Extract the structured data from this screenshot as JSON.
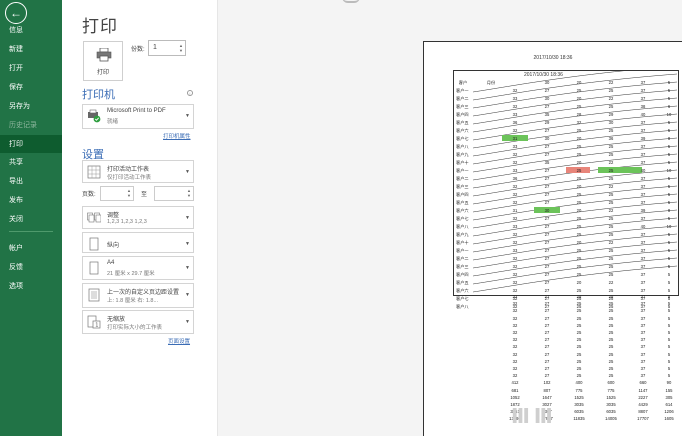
{
  "nav": {
    "back_glyph": "←",
    "items": [
      {
        "label": "信息",
        "state": "normal"
      },
      {
        "label": "新建",
        "state": "normal"
      },
      {
        "label": "打开",
        "state": "normal"
      },
      {
        "label": "保存",
        "state": "normal"
      },
      {
        "label": "另存为",
        "state": "normal"
      },
      {
        "label": "历史记录",
        "state": "disabled"
      },
      {
        "label": "打印",
        "state": "active"
      },
      {
        "label": "共享",
        "state": "normal"
      },
      {
        "label": "导出",
        "state": "normal"
      },
      {
        "label": "发布",
        "state": "normal"
      },
      {
        "label": "关闭",
        "state": "normal"
      },
      {
        "label": "帐户",
        "state": "normal"
      },
      {
        "label": "反馈",
        "state": "normal"
      },
      {
        "label": "选项",
        "state": "normal"
      }
    ]
  },
  "panel": {
    "title": "打印",
    "print_button_label": "打印",
    "copies_label": "份数:",
    "copies_value": "1",
    "printer_heading": "打印机",
    "printer_info_glyph": "i",
    "printer_name": "Microsoft Print to PDF",
    "printer_status": "就绪",
    "printer_properties_link": "打印机属性",
    "settings_heading": "设置",
    "settings": {
      "print_what": {
        "line1": "打印活动工作表",
        "line2": "仅打印活动工作表"
      },
      "pages_label": "页数:",
      "pages_to_label": "至",
      "collate": {
        "line1": "调整",
        "line2": "1,2,3    1,2,3    1,2,3"
      },
      "orientation": {
        "line1": "纵向"
      },
      "paper": {
        "line1": "A4",
        "line2": "21 厘米 x 29.7 厘米"
      },
      "margins": {
        "line1": "上一次的自定义页边距设置",
        "line2": "上: 1.8 厘米    右: 1.8..."
      },
      "scaling": {
        "line1": "无缩放",
        "line2": "打印实际大小的工作表"
      }
    },
    "page_setup_link": "页面设置"
  },
  "preview": {
    "page_header": "2017/10/30 18:36",
    "sheet_title": "2017/10/30 18:36",
    "header_row": [
      "客户",
      "月份",
      "30",
      "20",
      "22",
      "37",
      "5"
    ],
    "row_labels": [
      "客户一",
      "客户二",
      "客户三",
      "客户四",
      "客户五",
      "客户六",
      "客户七",
      "客户八",
      "客户九",
      "客户十",
      "客户一",
      "客户二",
      "客户三",
      "客户四",
      "客户五",
      "客户六",
      "客户七",
      "客户八",
      "客户九",
      "客户十",
      "客户一",
      "客户二",
      "客户三",
      "客户四",
      "客户五",
      "客户六",
      "客户七",
      "客户八"
    ],
    "rows": [
      [
        "32",
        "27",
        "25",
        "25",
        "37",
        "5"
      ],
      [
        "33",
        "30",
        "20",
        "22",
        "37",
        "5"
      ],
      [
        "32",
        "27",
        "25",
        "25",
        "38",
        "6"
      ],
      [
        "33",
        "35",
        "28",
        "29",
        "40",
        "10"
      ],
      [
        "36",
        "29",
        "32",
        "30",
        "37",
        "5"
      ],
      [
        "32",
        "27",
        "25",
        "25",
        "37",
        "5"
      ],
      [
        "31",
        "30",
        "20",
        "36",
        "39",
        "8"
      ],
      [
        "33",
        "27",
        "25",
        "25",
        "37",
        "5"
      ],
      [
        "32",
        "27",
        "25",
        "25",
        "37",
        "5"
      ],
      [
        "32",
        "35",
        "20",
        "22",
        "37",
        "5"
      ],
      [
        "33",
        "27",
        "25",
        "25",
        "40",
        "10"
      ],
      [
        "36",
        "27",
        "25",
        "25",
        "37",
        "5"
      ],
      [
        "32",
        "27",
        "20",
        "22",
        "37",
        "5"
      ],
      [
        "32",
        "27",
        "25",
        "25",
        "37",
        "5"
      ],
      [
        "32",
        "27",
        "25",
        "25",
        "37",
        "5"
      ],
      [
        "31",
        "30",
        "20",
        "22",
        "39",
        "8"
      ],
      [
        "32",
        "27",
        "25",
        "25",
        "37",
        "5"
      ],
      [
        "33",
        "27",
        "25",
        "25",
        "40",
        "10"
      ],
      [
        "32",
        "27",
        "25",
        "25",
        "37",
        "5"
      ],
      [
        "32",
        "27",
        "20",
        "22",
        "37",
        "5"
      ],
      [
        "33",
        "27",
        "25",
        "25",
        "37",
        "5"
      ],
      [
        "32",
        "27",
        "25",
        "25",
        "37",
        "5"
      ],
      [
        "32",
        "27",
        "25",
        "25",
        "37",
        "5"
      ],
      [
        "32",
        "27",
        "25",
        "25",
        "37",
        "5"
      ],
      [
        "32",
        "27",
        "20",
        "22",
        "37",
        "5"
      ],
      [
        "32",
        "27",
        "25",
        "25",
        "37",
        "5"
      ],
      [
        "32",
        "27",
        "25",
        "25",
        "37",
        "5"
      ],
      [
        "32",
        "27",
        "25",
        "25",
        "37",
        "5"
      ],
      [
        "32",
        "27",
        "25",
        "25",
        "37",
        "5"
      ],
      [
        "32",
        "27",
        "25",
        "25",
        "37",
        "5"
      ]
    ],
    "below_rows": [
      [
        "32",
        "27",
        "25",
        "25",
        "37",
        "5"
      ],
      [
        "32",
        "27",
        "25",
        "25",
        "37",
        "5"
      ],
      [
        "32",
        "27",
        "25",
        "25",
        "37",
        "5"
      ],
      [
        "32",
        "27",
        "25",
        "25",
        "37",
        "5"
      ],
      [
        "32",
        "27",
        "25",
        "25",
        "37",
        "5"
      ],
      [
        "32",
        "27",
        "25",
        "25",
        "37",
        "5"
      ],
      [
        "32",
        "27",
        "25",
        "25",
        "37",
        "5"
      ],
      [
        "32",
        "27",
        "25",
        "25",
        "37",
        "5"
      ],
      [
        "32",
        "27",
        "25",
        "25",
        "37",
        "5"
      ],
      [
        "32",
        "27",
        "25",
        "25",
        "37",
        "5"
      ],
      [
        "32",
        "27",
        "25",
        "25",
        "37",
        "5"
      ],
      [
        "32",
        "27",
        "25",
        "25",
        "37",
        "5"
      ],
      [
        "412",
        "102",
        "400",
        "600",
        "660",
        "90"
      ],
      [
        "681",
        "807",
        "775",
        "775",
        "1147",
        "155"
      ],
      [
        "1052",
        "1647",
        "1525",
        "1525",
        "2227",
        "305"
      ],
      [
        "1872",
        "3027",
        "3035",
        "3035",
        "4429",
        "614"
      ],
      [
        "3351",
        "6307",
        "6035",
        "6035",
        "8807",
        "1206"
      ],
      [
        "13391",
        "17967",
        "11835",
        "14005",
        "17707",
        "1605"
      ]
    ],
    "highlight_colors": {
      "green": "#6cc35a",
      "red": "#e8857a"
    }
  },
  "watermark": "ⅢⅢ"
}
